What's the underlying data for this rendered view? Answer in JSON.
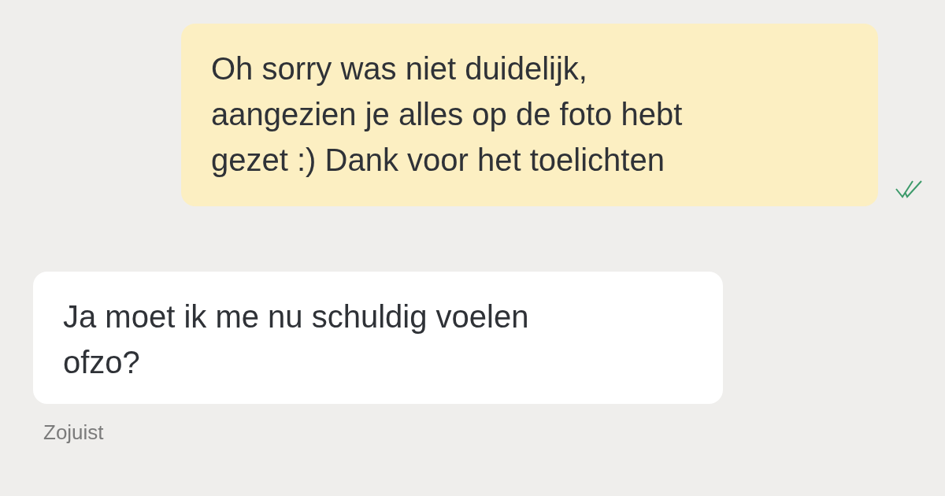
{
  "messages": [
    {
      "kind": "outgoing",
      "text": "Oh sorry was niet duidelijk,\naangezien je alles op de foto hebt\ngezet :) Dank voor het toelichten",
      "read": true
    },
    {
      "kind": "incoming",
      "text": "Ja moet ik me nu schuldig voelen\nofzo?"
    }
  ],
  "timestamp": "Zojuist"
}
